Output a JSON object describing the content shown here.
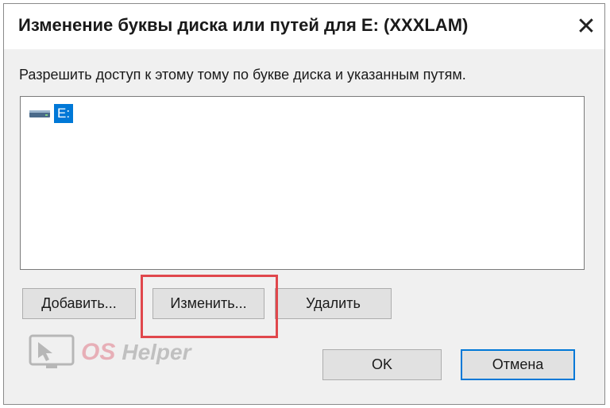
{
  "window": {
    "title": "Изменение буквы диска или путей для E: (XXXLAM)",
    "close_glyph": "✕"
  },
  "description": "Разрешить доступ к этому тому по букве диска и указанным путям.",
  "paths_list": {
    "items": [
      {
        "label": "E:",
        "icon": "drive-icon",
        "selected": true
      }
    ]
  },
  "buttons": {
    "add": "Добавить...",
    "change": "Изменить...",
    "delete": "Удалить",
    "ok": "OK",
    "cancel": "Отмена"
  },
  "watermark": {
    "part1": "OS",
    "part2": "Helper"
  },
  "colors": {
    "selection": "#0078d7",
    "highlight": "#e0474c"
  }
}
